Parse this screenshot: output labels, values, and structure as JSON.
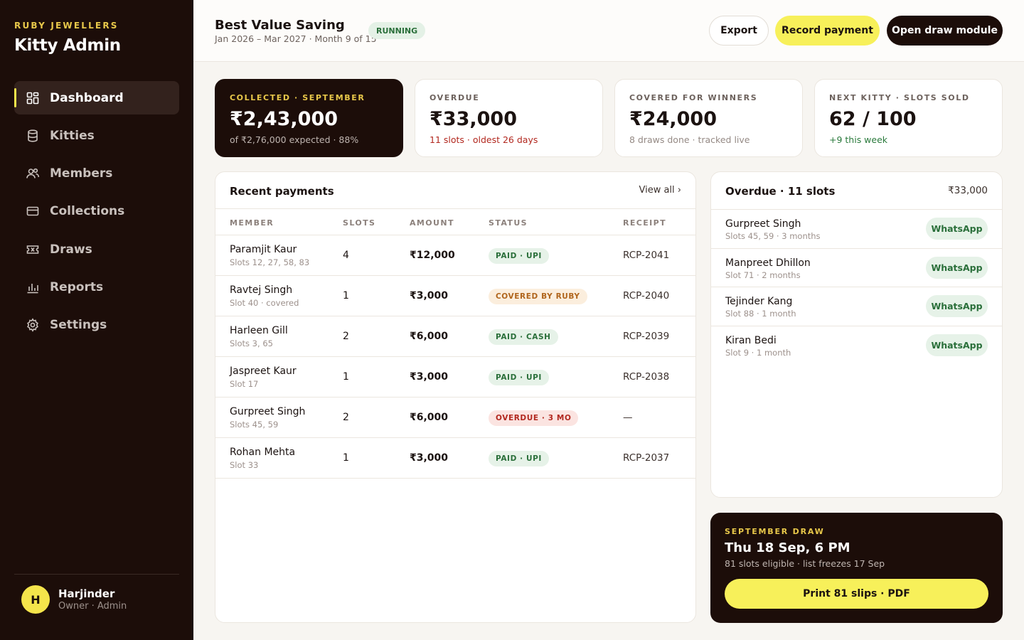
{
  "sidebar": {
    "brand_kicker": "RUBY JEWELLERS",
    "brand_title": "Kitty Admin",
    "nav": [
      {
        "label": "Dashboard",
        "icon": "dashboard-icon",
        "active": true
      },
      {
        "label": "Kitties",
        "icon": "database-icon"
      },
      {
        "label": "Members",
        "icon": "users-icon"
      },
      {
        "label": "Collections",
        "icon": "card-icon"
      },
      {
        "label": "Draws",
        "icon": "ticket-icon"
      },
      {
        "label": "Reports",
        "icon": "bar-chart-icon"
      },
      {
        "label": "Settings",
        "icon": "gear-icon"
      }
    ],
    "user": {
      "initial": "H",
      "name": "Harjinder",
      "role": "Owner · Admin"
    }
  },
  "header": {
    "title": "Best Value Saving",
    "subtitle": "Jan 2026 – Mar 2027 · Month 9 of 15",
    "status": "RUNNING",
    "export_label": "Export",
    "record_label": "Record payment",
    "draw_label": "Open draw module"
  },
  "kpis": [
    {
      "label": "COLLECTED · SEPTEMBER",
      "value": "₹2,43,000",
      "sub": "of ₹2,76,000 expected · 88%"
    },
    {
      "label": "OVERDUE",
      "value": "₹33,000",
      "sub": "11 slots · oldest 26 days"
    },
    {
      "label": "COVERED FOR WINNERS",
      "value": "₹24,000",
      "sub": "8 draws done · tracked live"
    },
    {
      "label": "NEXT KITTY · SLOTS SOLD",
      "value": "62 / 100",
      "sub": "+9 this week"
    }
  ],
  "payments": {
    "title": "Recent payments",
    "view_all": "View all ›",
    "columns": [
      "MEMBER",
      "SLOTS",
      "AMOUNT",
      "STATUS",
      "RECEIPT"
    ],
    "rows": [
      {
        "name": "Paramjit Kaur",
        "note": "Slots 12, 27, 58, 83",
        "slots": "4",
        "amount": "₹12,000",
        "status": "PAID · UPI",
        "status_type": "paid",
        "receipt": "RCP-2041"
      },
      {
        "name": "Ravtej Singh",
        "note": "Slot 40 · covered",
        "slots": "1",
        "amount": "₹3,000",
        "status": "COVERED BY RUBY",
        "status_type": "covered",
        "receipt": "RCP-2040"
      },
      {
        "name": "Harleen Gill",
        "note": "Slots 3, 65",
        "slots": "2",
        "amount": "₹6,000",
        "status": "PAID · CASH",
        "status_type": "paid",
        "receipt": "RCP-2039"
      },
      {
        "name": "Jaspreet Kaur",
        "note": "Slot 17",
        "slots": "1",
        "amount": "₹3,000",
        "status": "PAID · UPI",
        "status_type": "paid",
        "receipt": "RCP-2038"
      },
      {
        "name": "Gurpreet Singh",
        "note": "Slots 45, 59",
        "slots": "2",
        "amount": "₹6,000",
        "status": "OVERDUE · 3 MO",
        "status_type": "overdue",
        "receipt": "—"
      },
      {
        "name": "Rohan Mehta",
        "note": "Slot 33",
        "slots": "1",
        "amount": "₹3,000",
        "status": "PAID · UPI",
        "status_type": "paid",
        "receipt": "RCP-2037"
      }
    ]
  },
  "overdue": {
    "title": "Overdue · 11 slots",
    "amount": "₹33,000",
    "action_label": "WhatsApp",
    "items": [
      {
        "name": "Gurpreet Singh",
        "note": "Slots 45, 59 · 3 months"
      },
      {
        "name": "Manpreet Dhillon",
        "note": "Slot 71 · 2 months"
      },
      {
        "name": "Tejinder Kang",
        "note": "Slot 88 · 1 month"
      },
      {
        "name": "Kiran Bedi",
        "note": "Slot 9 · 1 month"
      }
    ]
  },
  "draw": {
    "kicker": "SEPTEMBER DRAW",
    "title": "Thu 18 Sep, 6 PM",
    "sub": "81 slots eligible · list freezes 17 Sep",
    "button": "Print 81 slips · PDF"
  },
  "colors": {
    "sidebar_bg": "#1c0d09",
    "accent_yellow": "#f7f05a",
    "gold": "#e8c84a",
    "paid_green": "#2a6f3a",
    "overdue_red": "#b2281f",
    "covered_orange": "#b0651c"
  }
}
